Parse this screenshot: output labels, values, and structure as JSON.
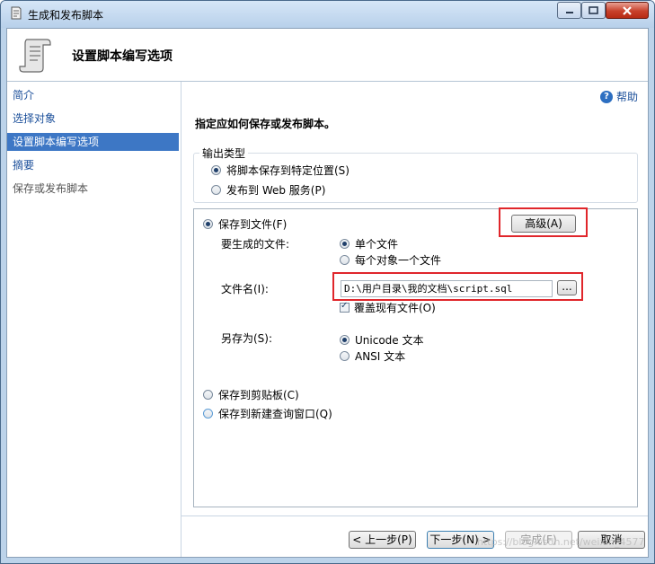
{
  "window": {
    "title": "生成和发布脚本",
    "header_title": "设置脚本编写选项"
  },
  "nav": {
    "items": [
      {
        "label": "简介"
      },
      {
        "label": "选择对象"
      },
      {
        "label": "设置脚本编写选项"
      },
      {
        "label": "摘要"
      },
      {
        "label": "保存或发布脚本"
      }
    ]
  },
  "main": {
    "help": "帮助",
    "instruction": "指定应如何保存或发布脚本。",
    "output_type": {
      "label": "输出类型",
      "option_file": "将脚本保存到特定位置(S)",
      "option_web": "发布到 Web 服务(P)"
    },
    "save_to_file": "保存到文件(F)",
    "advanced_button": "高级(A)",
    "files_to_generate": {
      "label": "要生成的文件:",
      "single": "单个文件",
      "per_object": "每个对象一个文件"
    },
    "file_name": {
      "label": "文件名(I):",
      "value": "D:\\用户目录\\我的文档\\script.sql",
      "browse": "..."
    },
    "overwrite": "覆盖现有文件(O)",
    "save_as": {
      "label": "另存为(S):",
      "unicode": "Unicode 文本",
      "ansi": "ANSI 文本"
    },
    "save_to_clipboard": "保存到剪贴板(C)",
    "save_to_query_window": "保存到新建查询窗口(Q)"
  },
  "footer": {
    "prev": "< 上一步(P)",
    "next": "下一步(N) >",
    "finish": "完成(F)",
    "cancel": "取消"
  },
  "watermark": "https://blog.csdn.net/weixin_4577"
}
